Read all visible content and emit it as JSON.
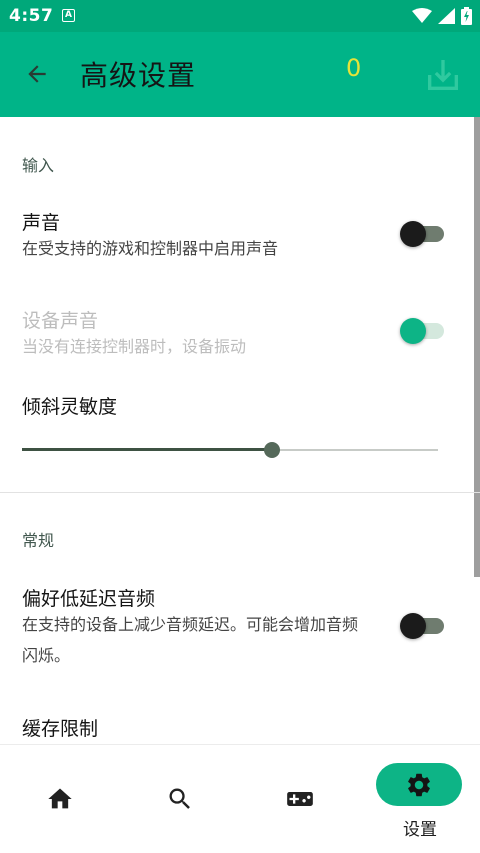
{
  "status_bar": {
    "time": "4:57",
    "notification_letter": "A"
  },
  "app_bar": {
    "title": "高级设置",
    "counter": "0",
    "back_icon": "arrow-back-icon",
    "download_icon": "download-icon"
  },
  "sections": {
    "input": {
      "header": "输入"
    },
    "general": {
      "header": "常规"
    }
  },
  "prefs": {
    "sound": {
      "title": "声音",
      "summary": "在受支持的游戏和控制器中启用声音",
      "enabled": false
    },
    "device_sound": {
      "title": "设备声音",
      "summary": "当没有连接控制器时，设备振动",
      "enabled": true,
      "disabled_state": true
    },
    "tilt_sensitivity": {
      "title": "倾斜灵敏度",
      "value": 0.6
    },
    "low_latency_audio": {
      "title": "偏好低延迟音频",
      "summary": "在支持的设备上减少音频延迟。可能会增加音频闪烁。",
      "enabled": false
    },
    "cache_limit": {
      "title": "缓存限制"
    }
  },
  "bottom_nav": {
    "items": [
      {
        "icon": "home-icon",
        "label": ""
      },
      {
        "icon": "search-icon",
        "label": ""
      },
      {
        "icon": "gamepad-icon",
        "label": ""
      },
      {
        "icon": "gear-icon",
        "label": "设置",
        "selected": true
      }
    ]
  },
  "colors": {
    "app_bar": "#00b488",
    "status_bar": "#00a87a",
    "accent": "#0db486",
    "counter": "#e5e33a"
  }
}
